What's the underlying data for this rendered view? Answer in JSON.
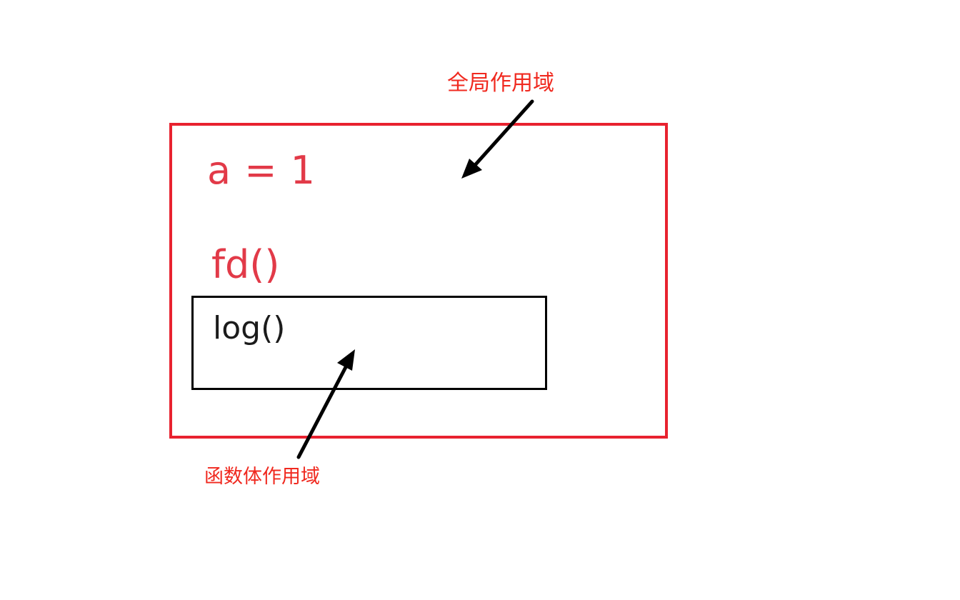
{
  "global_scope": {
    "label": "全局作用域",
    "border_color": "#e8222f",
    "statements": {
      "assignment": "a = 1",
      "call": "fd()"
    }
  },
  "function_scope": {
    "label": "函数体作用域",
    "border_color": "#000000",
    "statements": {
      "call": "log()"
    }
  },
  "colors": {
    "code_red": "#e23a48",
    "label_red": "#f0291f",
    "arrow": "#000000"
  }
}
